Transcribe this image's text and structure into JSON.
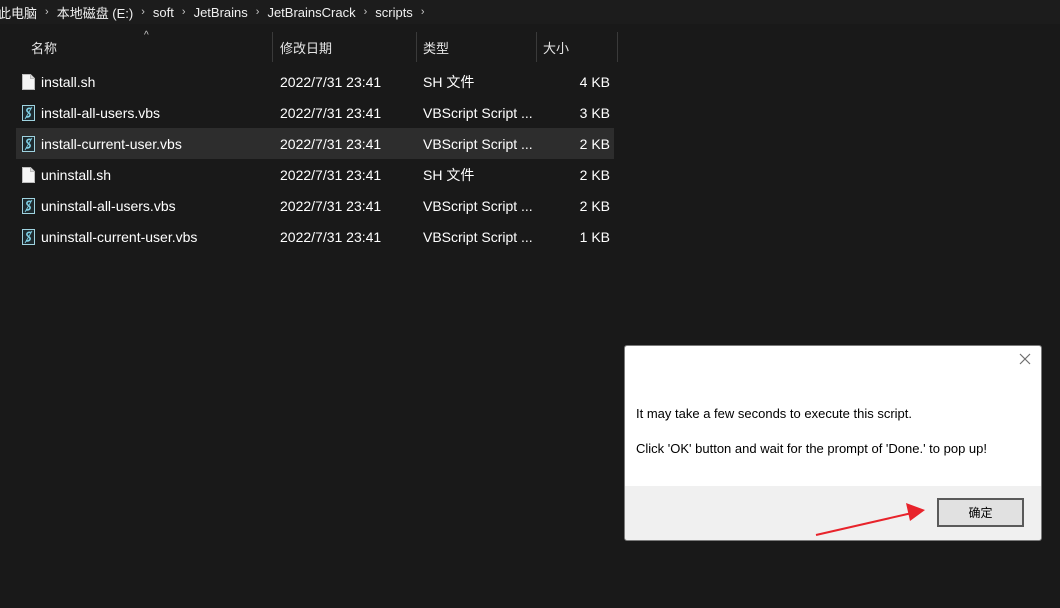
{
  "breadcrumb": [
    "此电脑",
    "本地磁盘 (E:)",
    "soft",
    "JetBrains",
    "JetBrainsCrack",
    "scripts"
  ],
  "columns": {
    "name": "名称",
    "date": "修改日期",
    "type": "类型",
    "size": "大小"
  },
  "files": [
    {
      "name": "install.sh",
      "date": "2022/7/31 23:41",
      "type": "SH 文件",
      "size": "4 KB",
      "icon": "file-icon"
    },
    {
      "name": "install-all-users.vbs",
      "date": "2022/7/31 23:41",
      "type": "VBScript Script ...",
      "size": "3 KB",
      "icon": "vbscript-icon"
    },
    {
      "name": "install-current-user.vbs",
      "date": "2022/7/31 23:41",
      "type": "VBScript Script ...",
      "size": "2 KB",
      "icon": "vbscript-icon"
    },
    {
      "name": "uninstall.sh",
      "date": "2022/7/31 23:41",
      "type": "SH 文件",
      "size": "2 KB",
      "icon": "file-icon"
    },
    {
      "name": "uninstall-all-users.vbs",
      "date": "2022/7/31 23:41",
      "type": "VBScript Script ...",
      "size": "2 KB",
      "icon": "vbscript-icon"
    },
    {
      "name": "uninstall-current-user.vbs",
      "date": "2022/7/31 23:41",
      "type": "VBScript Script ...",
      "size": "1 KB",
      "icon": "vbscript-icon"
    }
  ],
  "selected_row": 2,
  "dialog": {
    "message1": "It may take a few seconds to execute this script.",
    "message2": "Click 'OK' button and wait for the prompt of 'Done.' to pop up!",
    "ok_label": "确定"
  },
  "colors": {
    "background": "#191919",
    "selection": "#2d2d2d",
    "annotation_arrow": "#e8232b"
  }
}
